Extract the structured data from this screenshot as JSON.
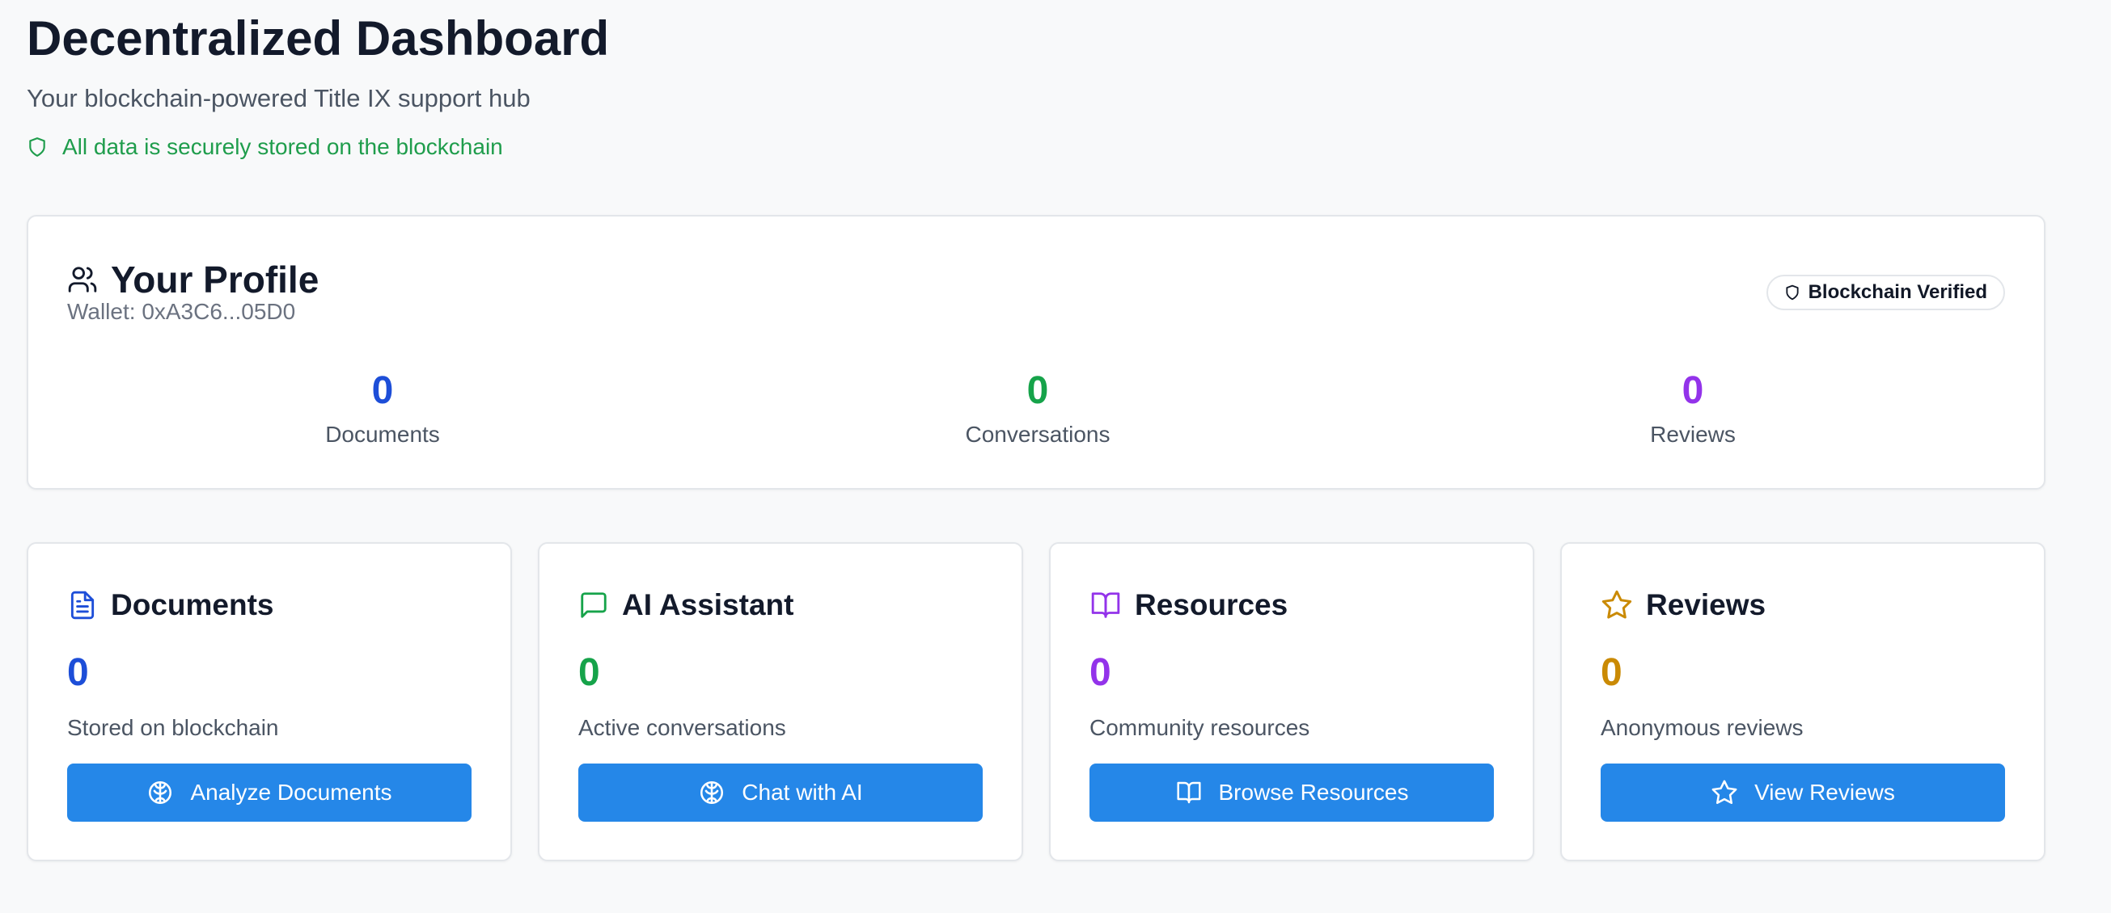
{
  "header": {
    "title": "Decentralized Dashboard",
    "subtitle": "Your blockchain-powered Title IX support hub",
    "secure_note": "All data is securely stored on the blockchain"
  },
  "profile": {
    "title": "Your Profile",
    "wallet": "Wallet: 0xA3C6...05D0",
    "badge": "Blockchain Verified",
    "stats": [
      {
        "value": "0",
        "label": "Documents",
        "color": "#1d4ed8"
      },
      {
        "value": "0",
        "label": "Conversations",
        "color": "#16a34a"
      },
      {
        "value": "0",
        "label": "Reviews",
        "color": "#9333ea"
      }
    ]
  },
  "cards": [
    {
      "title": "Documents",
      "value": "0",
      "description": "Stored on blockchain",
      "button": "Analyze Documents",
      "icon": "file-text-icon",
      "color": "#1d4ed8"
    },
    {
      "title": "AI Assistant",
      "value": "0",
      "description": "Active conversations",
      "button": "Chat with AI",
      "icon": "message-square-icon",
      "color": "#16a34a"
    },
    {
      "title": "Resources",
      "value": "0",
      "description": "Community resources",
      "button": "Browse Resources",
      "icon": "book-open-icon",
      "color": "#9333ea"
    },
    {
      "title": "Reviews",
      "value": "0",
      "description": "Anonymous reviews",
      "button": "View Reviews",
      "icon": "star-icon",
      "color": "#ca8a04"
    }
  ],
  "colors": {
    "accent": "#2587e8",
    "success": "#1f9d4c"
  }
}
